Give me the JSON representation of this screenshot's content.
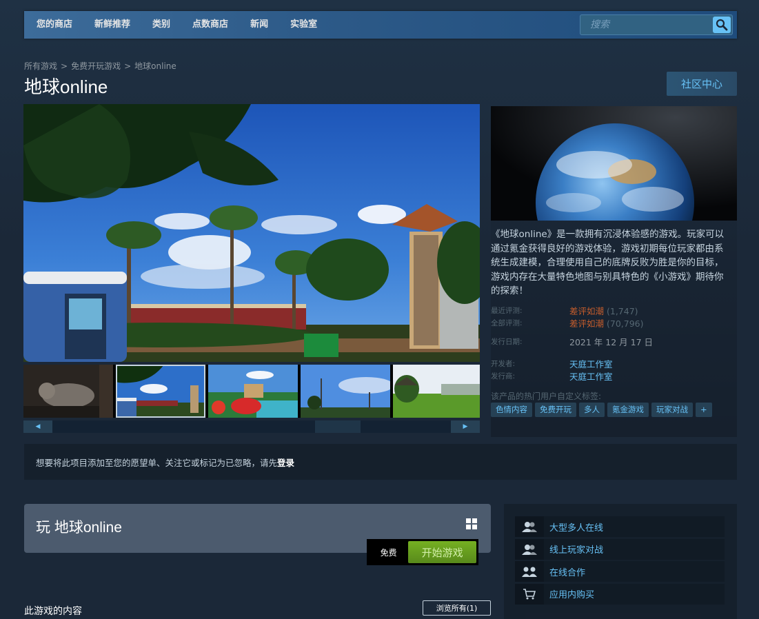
{
  "nav": {
    "items": [
      "您的商店",
      "新鲜推荐",
      "类别",
      "点数商店",
      "新闻",
      "实验室"
    ],
    "search_placeholder": "搜索"
  },
  "breadcrumb": [
    "所有游戏",
    "免费开玩游戏",
    "地球online"
  ],
  "page_title": "地球online",
  "community_button": "社区中心",
  "description": "《地球online》是一款拥有沉浸体验感的游戏。玩家可以通过氪金获得良好的游戏体验，游戏初期每位玩家都由系统生成建模，合理使用自己的底牌反败为胜是你的目标，游戏内存在大量特色地图与别具特色的《小游戏》期待你的探索！",
  "reviews": {
    "recent_label": "最近评测:",
    "recent_value": "差评如潮",
    "recent_count": "(1,747)",
    "all_label": "全部评测:",
    "all_value": "差评如潮",
    "all_count": "(70,796)"
  },
  "release": {
    "label": "发行日期:",
    "value": "2021 年 12 月 17 日"
  },
  "developer": {
    "label": "开发者:",
    "value": "天庭工作室"
  },
  "publisher": {
    "label": "发行商:",
    "value": "天庭工作室"
  },
  "tags_label": "该产品的热门用户自定义标签:",
  "tags": [
    "色情内容",
    "免费开玩",
    "多人",
    "氪金游戏",
    "玩家对战",
    "+"
  ],
  "login_bar": {
    "text": "想要将此项目添加至您的愿望单、关注它或标记为已忽略，请先",
    "link": "登录"
  },
  "purchase": {
    "title": "玩 地球online",
    "price": "免费",
    "button": "开始游戏"
  },
  "content_section": {
    "title": "此游戏的内容",
    "browse": "浏览所有(1)"
  },
  "features": [
    "大型多人在线",
    "线上玩家对战",
    "在线合作",
    "应用内购买"
  ],
  "colors": {
    "accent": "#67c1f5",
    "negative_review": "#c35c2c",
    "play_button": "#75b022",
    "background": "#1b2838"
  }
}
